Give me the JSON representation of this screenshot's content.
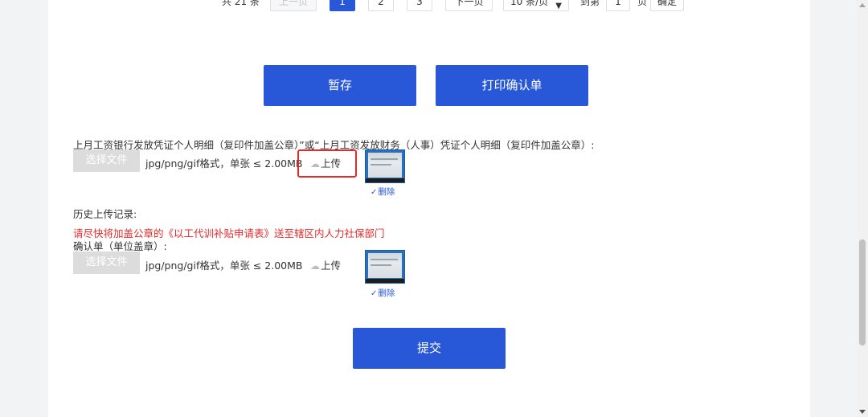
{
  "pagination": {
    "total_text": "共 21 条",
    "prev_label": "上一页",
    "pages": [
      "1",
      "2",
      "3"
    ],
    "active_page": "1",
    "next_label": "下一页",
    "page_size": "10 条/页",
    "goto_label": "到第",
    "goto_value": "1",
    "page_unit": "页",
    "confirm_label": "确定"
  },
  "actions": {
    "save_label": "暂存",
    "print_label": "打印确认单",
    "submit_label": "提交"
  },
  "section1": {
    "title": "上月工资银行发放凭证个人明细（复印件加盖公章）”或“上月工资发放财务（人事）凭证个人明细（复印件加盖公章）:",
    "choose_label": "选择文件",
    "hint": "jpg/png/gif格式，单张 ≤ 2.00MB",
    "upload_label": "上传",
    "delete_label": "删除"
  },
  "history": {
    "title": "历史上传记录:",
    "notice": "请尽快将加盖公章的《以工代训补贴申请表》送至辖区内人力社保部门"
  },
  "section2": {
    "title": "确认单（单位盖章）:",
    "choose_label": "选择文件",
    "hint": "jpg/png/gif格式，单张 ≤ 2.00MB",
    "upload_label": "上传",
    "delete_label": "删除"
  },
  "colors": {
    "primary": "#2857d8",
    "warning": "#e22b2b",
    "disabled": "#dcdcdc"
  },
  "icons": {
    "upload": "cloud-icon",
    "delete": "check-icon"
  }
}
